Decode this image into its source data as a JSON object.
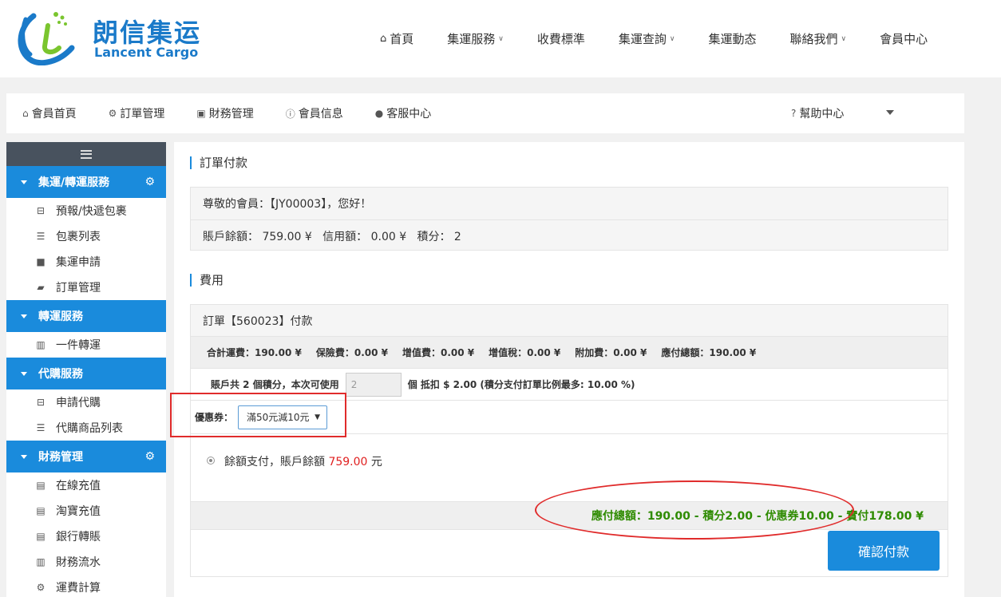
{
  "brand": {
    "name_cn": "朗信集运",
    "name_en": "Lancent Cargo"
  },
  "top_nav": {
    "items": [
      {
        "label": "首頁",
        "icon": "home-icon"
      },
      {
        "label": "集運服務",
        "dropdown": true
      },
      {
        "label": "收費標準"
      },
      {
        "label": "集運查詢",
        "dropdown": true
      },
      {
        "label": "集運動态"
      },
      {
        "label": "聯絡我們",
        "dropdown": true
      },
      {
        "label": "會員中心"
      }
    ]
  },
  "member_nav": {
    "items": [
      {
        "label": "會員首頁",
        "icon": "home-icon"
      },
      {
        "label": "訂單管理",
        "icon": "gear-icon"
      },
      {
        "label": "財務管理",
        "icon": "money-icon"
      },
      {
        "label": "會員信息",
        "icon": "info-icon"
      },
      {
        "label": "客服中心",
        "icon": "user-icon"
      }
    ],
    "help": {
      "label": "幫助中心",
      "icon": "question-icon"
    }
  },
  "sidebar": {
    "groups": [
      {
        "title": "集運/轉運服務",
        "gear": true,
        "items": [
          {
            "label": "預報/快遞包裹",
            "icon": "inbox-icon"
          },
          {
            "label": "包裹列表",
            "icon": "list-icon"
          },
          {
            "label": "集運申請",
            "icon": "truck-icon"
          },
          {
            "label": "訂單管理",
            "icon": "book-icon"
          }
        ]
      },
      {
        "title": "轉運服務",
        "gear": false,
        "items": [
          {
            "label": "一件轉運",
            "icon": "bar-chart-icon"
          }
        ]
      },
      {
        "title": "代購服務",
        "gear": false,
        "items": [
          {
            "label": "申請代購",
            "icon": "inbox-icon"
          },
          {
            "label": "代購商品列表",
            "icon": "list-icon"
          }
        ]
      },
      {
        "title": "財務管理",
        "gear": true,
        "items": [
          {
            "label": "在線充值",
            "icon": "card-icon"
          },
          {
            "label": "淘寶充值",
            "icon": "card-icon"
          },
          {
            "label": "銀行轉賬",
            "icon": "card-icon"
          },
          {
            "label": "財務流水",
            "icon": "bar-chart-icon"
          },
          {
            "label": "運費計算",
            "icon": "cogs-icon"
          }
        ]
      }
    ]
  },
  "order_payment": {
    "title": "訂單付款",
    "greeting": "尊敬的會員：【JY00003】，您好！",
    "balance_line": "賬戶餘額： 759.00 ¥   信用額： 0.00 ¥   積分： 2"
  },
  "fees": {
    "title": "費用",
    "order_header": "訂單【560023】付款",
    "summary": [
      "合計運費：190.00 ¥",
      "保險費：0.00 ¥",
      "增值費：0.00 ¥",
      "增值稅：0.00 ¥",
      "附加費：0.00 ¥",
      "應付總額：190.00 ¥"
    ],
    "points_prefix": "賬戶共 2 個積分，本次可使用",
    "points_value": "2",
    "points_suffix": "個 抵扣 $ 2.00 (積分支付訂單比例最多: 10.00 %)",
    "coupon_label": "優惠券：",
    "coupon_selected": "滿50元減10元",
    "pay_method_prefix": "餘額支付，賬戶餘額",
    "pay_method_amount": "759.00",
    "pay_method_unit": "元",
    "total_line": "應付總額：190.00 - 積分2.00 - 优惠券10.00 - 實付178.00 ¥",
    "confirm_label": "確認付款"
  },
  "colors": {
    "accent": "#1a8bdc",
    "sidebar_top": "#48525e",
    "total_green": "#2e8b00",
    "highlight_red": "#e02020"
  }
}
